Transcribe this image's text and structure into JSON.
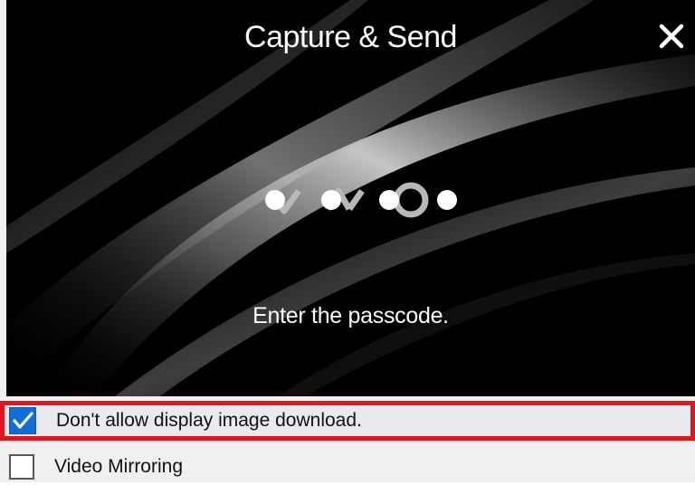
{
  "dialog": {
    "title": "Capture & Send",
    "close_icon": "close-icon",
    "logo": "vaio-logo",
    "prompt": "Enter the passcode.",
    "passcode_length": 4
  },
  "options": [
    {
      "label": "Don't allow display image download.",
      "checked": true,
      "highlighted": true,
      "highlight_color": "#e0161e"
    },
    {
      "label": "Video Mirroring",
      "checked": false,
      "highlighted": false
    }
  ],
  "colors": {
    "hero_background": "#000000",
    "checkbox_checked": "#0f6fd6",
    "panel_background": "#f0f0f0"
  }
}
